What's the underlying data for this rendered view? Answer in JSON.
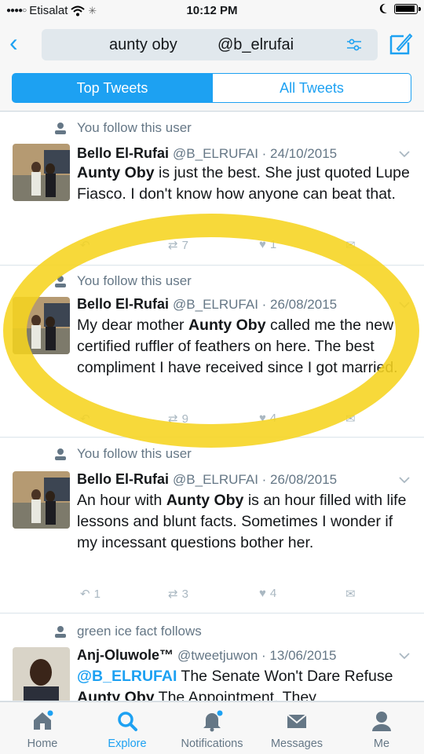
{
  "status_bar": {
    "carrier": "Etisalat",
    "time": "10:12 PM"
  },
  "header": {
    "search_query": "aunty oby",
    "search_handle": "@b_elrufai"
  },
  "tabs": {
    "top": "Top Tweets",
    "all": "All Tweets"
  },
  "tweets": [
    {
      "context": "You follow this user",
      "name": "Bello El-Rufai",
      "handle_date": "@B_ELRUFAI · 24/10/2015",
      "text_bold": "Aunty Oby",
      "text_rest": " is just the best. She just quoted Lupe Fiasco. I don't know how anyone can beat that.",
      "reply_count": "",
      "retweet_count": "7",
      "like_count": "1"
    },
    {
      "context": "You follow this user",
      "name": "Bello El-Rufai",
      "handle_date": "@B_ELRUFAI · 26/08/2015",
      "text_pre": "My dear mother ",
      "text_bold": "Aunty Oby",
      "text_rest": " called me the new certified ruffler of feathers on here. The best compliment I have received since I got married.",
      "reply_count": "",
      "retweet_count": "9",
      "like_count": "4"
    },
    {
      "context": "You follow this user",
      "name": "Bello El-Rufai",
      "handle_date": "@B_ELRUFAI · 26/08/2015",
      "text_pre": "An hour with ",
      "text_bold": "Aunty Oby",
      "text_rest": " is an hour filled with life lessons and blunt facts. Sometimes I wonder if my incessant questions bother her.",
      "reply_count": "1",
      "retweet_count": "3",
      "like_count": "4"
    },
    {
      "context": "green ice fact follows",
      "name": "Anj-Oluwole™",
      "handle_date": "@tweetjuwon · 13/06/2015",
      "mention": "@B_ELRUFAI",
      "text_mid": " The Senate Won't Dare Refuse ",
      "text_bold": "Aunty Oby",
      "text_rest": " The Appointment. They"
    }
  ],
  "tabbar": {
    "home": "Home",
    "explore": "Explore",
    "notifications": "Notifications",
    "messages": "Messages",
    "me": "Me"
  },
  "colors": {
    "accent": "#1da1f2",
    "highlight": "#f6d41f",
    "muted": "#657786"
  }
}
